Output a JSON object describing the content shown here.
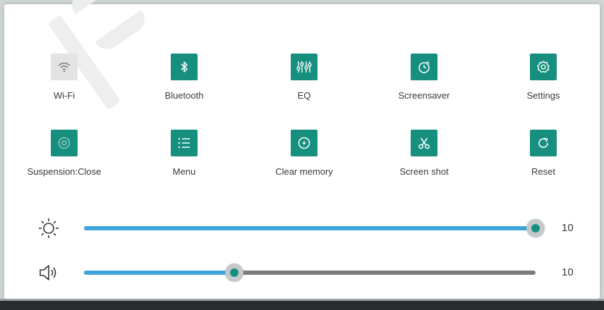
{
  "tiles_row1": [
    {
      "name": "wifi",
      "label": "Wi-Fi",
      "icon": "wifi-icon",
      "active": false
    },
    {
      "name": "bluetooth",
      "label": "Bluetooth",
      "icon": "bluetooth-icon",
      "active": true
    },
    {
      "name": "eq",
      "label": "EQ",
      "icon": "equalizer-icon",
      "active": true
    },
    {
      "name": "screensaver",
      "label": "Screensaver",
      "icon": "timer-icon",
      "active": true
    },
    {
      "name": "settings",
      "label": "Settings",
      "icon": "gear-icon",
      "active": true
    }
  ],
  "tiles_row2": [
    {
      "name": "suspension",
      "label": "Suspension:Close",
      "icon": "suspension-icon",
      "active": true
    },
    {
      "name": "menu",
      "label": "Menu",
      "icon": "list-icon",
      "active": true
    },
    {
      "name": "clear-memory",
      "label": "Clear memory",
      "icon": "rocket-clean-icon",
      "active": true
    },
    {
      "name": "screenshot",
      "label": "Screen shot",
      "icon": "scissors-icon",
      "active": true
    },
    {
      "name": "reset",
      "label": "Reset",
      "icon": "refresh-icon",
      "active": true
    }
  ],
  "brightness": {
    "icon": "sun-icon",
    "value": "10",
    "level": 1.0
  },
  "volume": {
    "icon": "speaker-icon",
    "value": "10",
    "level": 0.333
  },
  "colors": {
    "accent": "#168f7f",
    "slider_fill": "#3fa6dc",
    "slider_track": "#7b7b7b"
  }
}
